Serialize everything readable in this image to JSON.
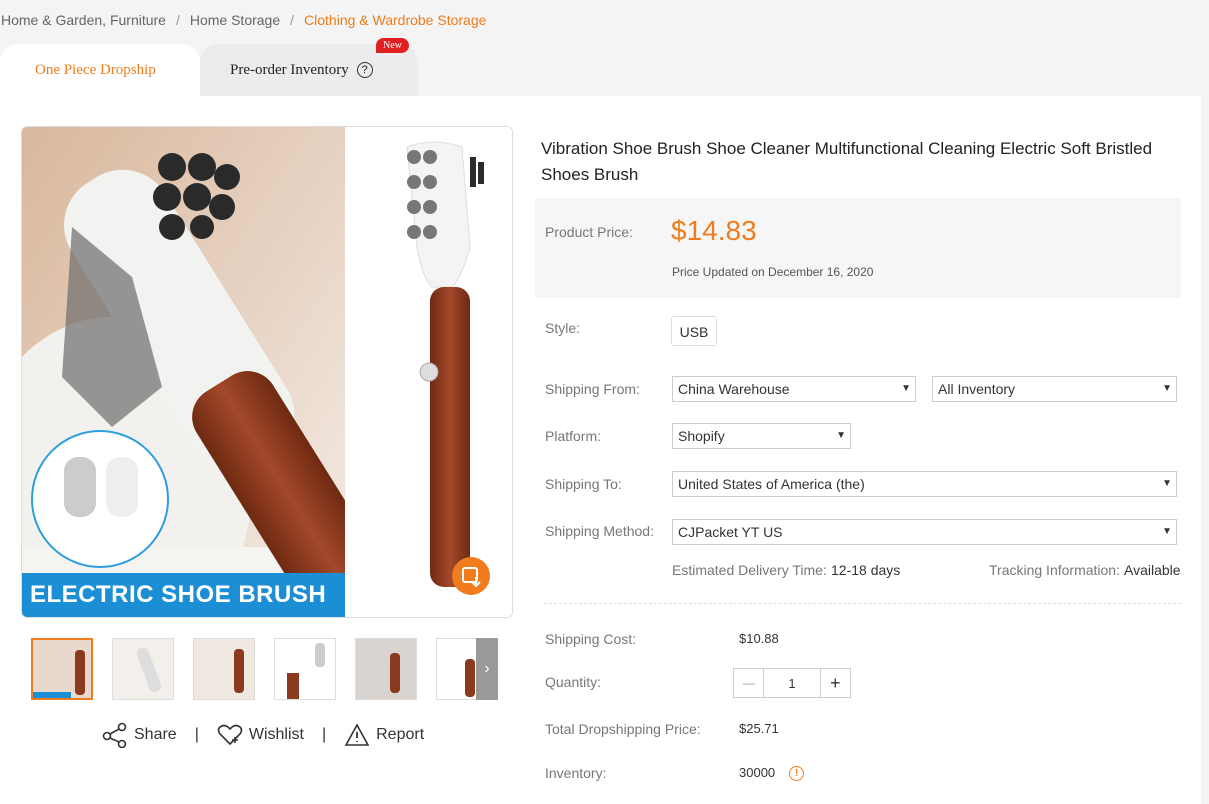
{
  "breadcrumb": {
    "items": [
      "Home & Garden, Furniture",
      "Home Storage"
    ],
    "current": "Clothing & Wardrobe Storage",
    "separator": "/"
  },
  "tabs": {
    "dropship": "One Piece Dropship",
    "preorder": "Pre-order Inventory",
    "help_glyph": "?",
    "new_badge": "New"
  },
  "gallery": {
    "banner_text": "ELECTRIC SHOE BRUSH",
    "next_glyph": "›"
  },
  "actions": {
    "share": "Share",
    "wishlist": "Wishlist",
    "report": "Report",
    "separator": "|"
  },
  "product": {
    "title": "Vibration Shoe Brush Shoe Cleaner Multifunctional Cleaning Electric Soft Bristled Shoes Brush",
    "price_label": "Product Price:",
    "price": "$14.83",
    "price_updated": "Price Updated on December 16, 2020",
    "style_label": "Style:",
    "style_value": "USB",
    "shipping_from_label": "Shipping From:",
    "shipping_from_value": "China Warehouse",
    "inventory_scope": "All Inventory",
    "platform_label": "Platform:",
    "platform_value": "Shopify",
    "shipping_to_label": "Shipping To:",
    "shipping_to_value": "United States of America (the)",
    "shipping_method_label": "Shipping Method:",
    "shipping_method_value": "CJPacket YT US",
    "delivery_label": "Estimated Delivery Time:",
    "delivery_value": "12-18 days",
    "tracking_label": "Tracking Information:",
    "tracking_value": "Available",
    "shipping_cost_label": "Shipping Cost:",
    "shipping_cost_value": "$10.88",
    "quantity_label": "Quantity:",
    "quantity_value": "1",
    "minus": "—",
    "plus": "+",
    "total_label": "Total Dropshipping Price:",
    "total_value": "$25.71",
    "inventory_label": "Inventory:",
    "inventory_value": "30000",
    "warn_glyph": "!"
  },
  "colors": {
    "accent": "#f07c1d",
    "banner": "#1c8ed6",
    "wood": "#8b3a1e"
  }
}
